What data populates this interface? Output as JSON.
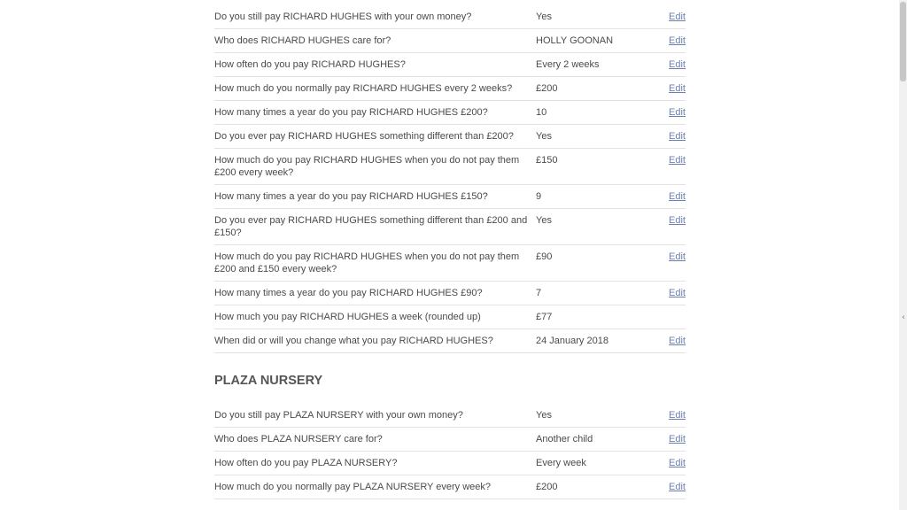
{
  "sections": [
    {
      "title": "",
      "rows": [
        {
          "question": "Do you still pay RICHARD HUGHES with your own money?",
          "answer": "Yes",
          "action": "Edit"
        },
        {
          "question": "Who does RICHARD HUGHES care for?",
          "answer": "HOLLY GOONAN",
          "action": "Edit"
        },
        {
          "question": "How often do you pay RICHARD HUGHES?",
          "answer": "Every 2 weeks",
          "action": "Edit"
        },
        {
          "question": "How much do you normally pay RICHARD HUGHES every 2 weeks?",
          "answer": "£200",
          "action": "Edit"
        },
        {
          "question": "How many times a year do you pay RICHARD HUGHES £200?",
          "answer": "10",
          "action": "Edit"
        },
        {
          "question": "Do you ever pay RICHARD HUGHES something different than £200?",
          "answer": "Yes",
          "action": "Edit"
        },
        {
          "question": "How much do you pay RICHARD HUGHES when you do not pay them £200 every week?",
          "answer": "£150",
          "action": "Edit"
        },
        {
          "question": "How many times a year do you pay RICHARD HUGHES £150?",
          "answer": "9",
          "action": "Edit"
        },
        {
          "question": "Do you ever pay RICHARD HUGHES something different than £200 and £150?",
          "answer": "Yes",
          "action": "Edit"
        },
        {
          "question": "How much do you pay RICHARD HUGHES when you do not pay them £200 and £150 every week?",
          "answer": "£90",
          "action": "Edit"
        },
        {
          "question": "How many times a year do you pay RICHARD HUGHES £90?",
          "answer": "7",
          "action": "Edit"
        },
        {
          "question": "How much you pay RICHARD HUGHES a week (rounded up)",
          "answer": "£77",
          "action": ""
        },
        {
          "question": "When did or will you change what you pay RICHARD HUGHES?",
          "answer": "24 January 2018",
          "action": "Edit"
        }
      ]
    },
    {
      "title": "PLAZA NURSERY",
      "rows": [
        {
          "question": "Do you still pay PLAZA NURSERY with your own money?",
          "answer": "Yes",
          "action": "Edit"
        },
        {
          "question": "Who does PLAZA NURSERY care for?",
          "answer": "Another child",
          "action": "Edit"
        },
        {
          "question": "How often do you pay PLAZA NURSERY?",
          "answer": "Every week",
          "action": "Edit"
        },
        {
          "question": "How much do you normally pay PLAZA NURSERY every week?",
          "answer": "£200",
          "action": "Edit"
        }
      ]
    }
  ],
  "scrollbar": {
    "collapse_glyph": "‹"
  }
}
